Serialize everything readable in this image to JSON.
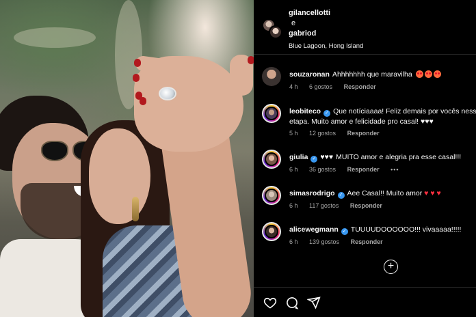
{
  "header": {
    "user1": "gilancellotti",
    "conjunction": "e",
    "user2": "gabriod",
    "location": "Blue Lagoon, Hong Island"
  },
  "comments": [
    {
      "user": "souzaronan",
      "verified": false,
      "text": "Ahhhhhhh que maravilha",
      "time": "4 h",
      "likes": "6 gostos",
      "reply": "Responder"
    },
    {
      "user": "leobiteco",
      "verified": true,
      "text": "Que notíciaaaa! Feliz demais por vocês nessa etapa. Muito amor e felicidade pro casal! ♥♥♥",
      "time": "5 h",
      "likes": "12 gostos",
      "reply": "Responder"
    },
    {
      "user": "giulia",
      "verified": true,
      "text_before": "♥♥♥",
      "text": "MUITO amor e alegria pra esse casal!!!",
      "time": "6 h",
      "likes": "36 gostos",
      "reply": "Responder",
      "more": "•••"
    },
    {
      "user": "simasrodrigo",
      "verified": true,
      "text": "Aee Casal!! Muito amor",
      "time": "6 h",
      "likes": "117 gostos",
      "reply": "Responder"
    },
    {
      "user": "alicewegmann",
      "verified": true,
      "text": "TUUUUDOOOOOO!!! vivaaaaa!!!!!",
      "time": "6 h",
      "likes": "139 gostos",
      "reply": "Responder"
    }
  ],
  "icons": {
    "add_comments": "plus-circle-icon",
    "like": "heart-icon",
    "comment": "comment-icon",
    "share": "share-icon"
  },
  "colors": {
    "heart": "#ff3040",
    "verified": "#3897f0",
    "meta_text": "#a8a8a8"
  }
}
